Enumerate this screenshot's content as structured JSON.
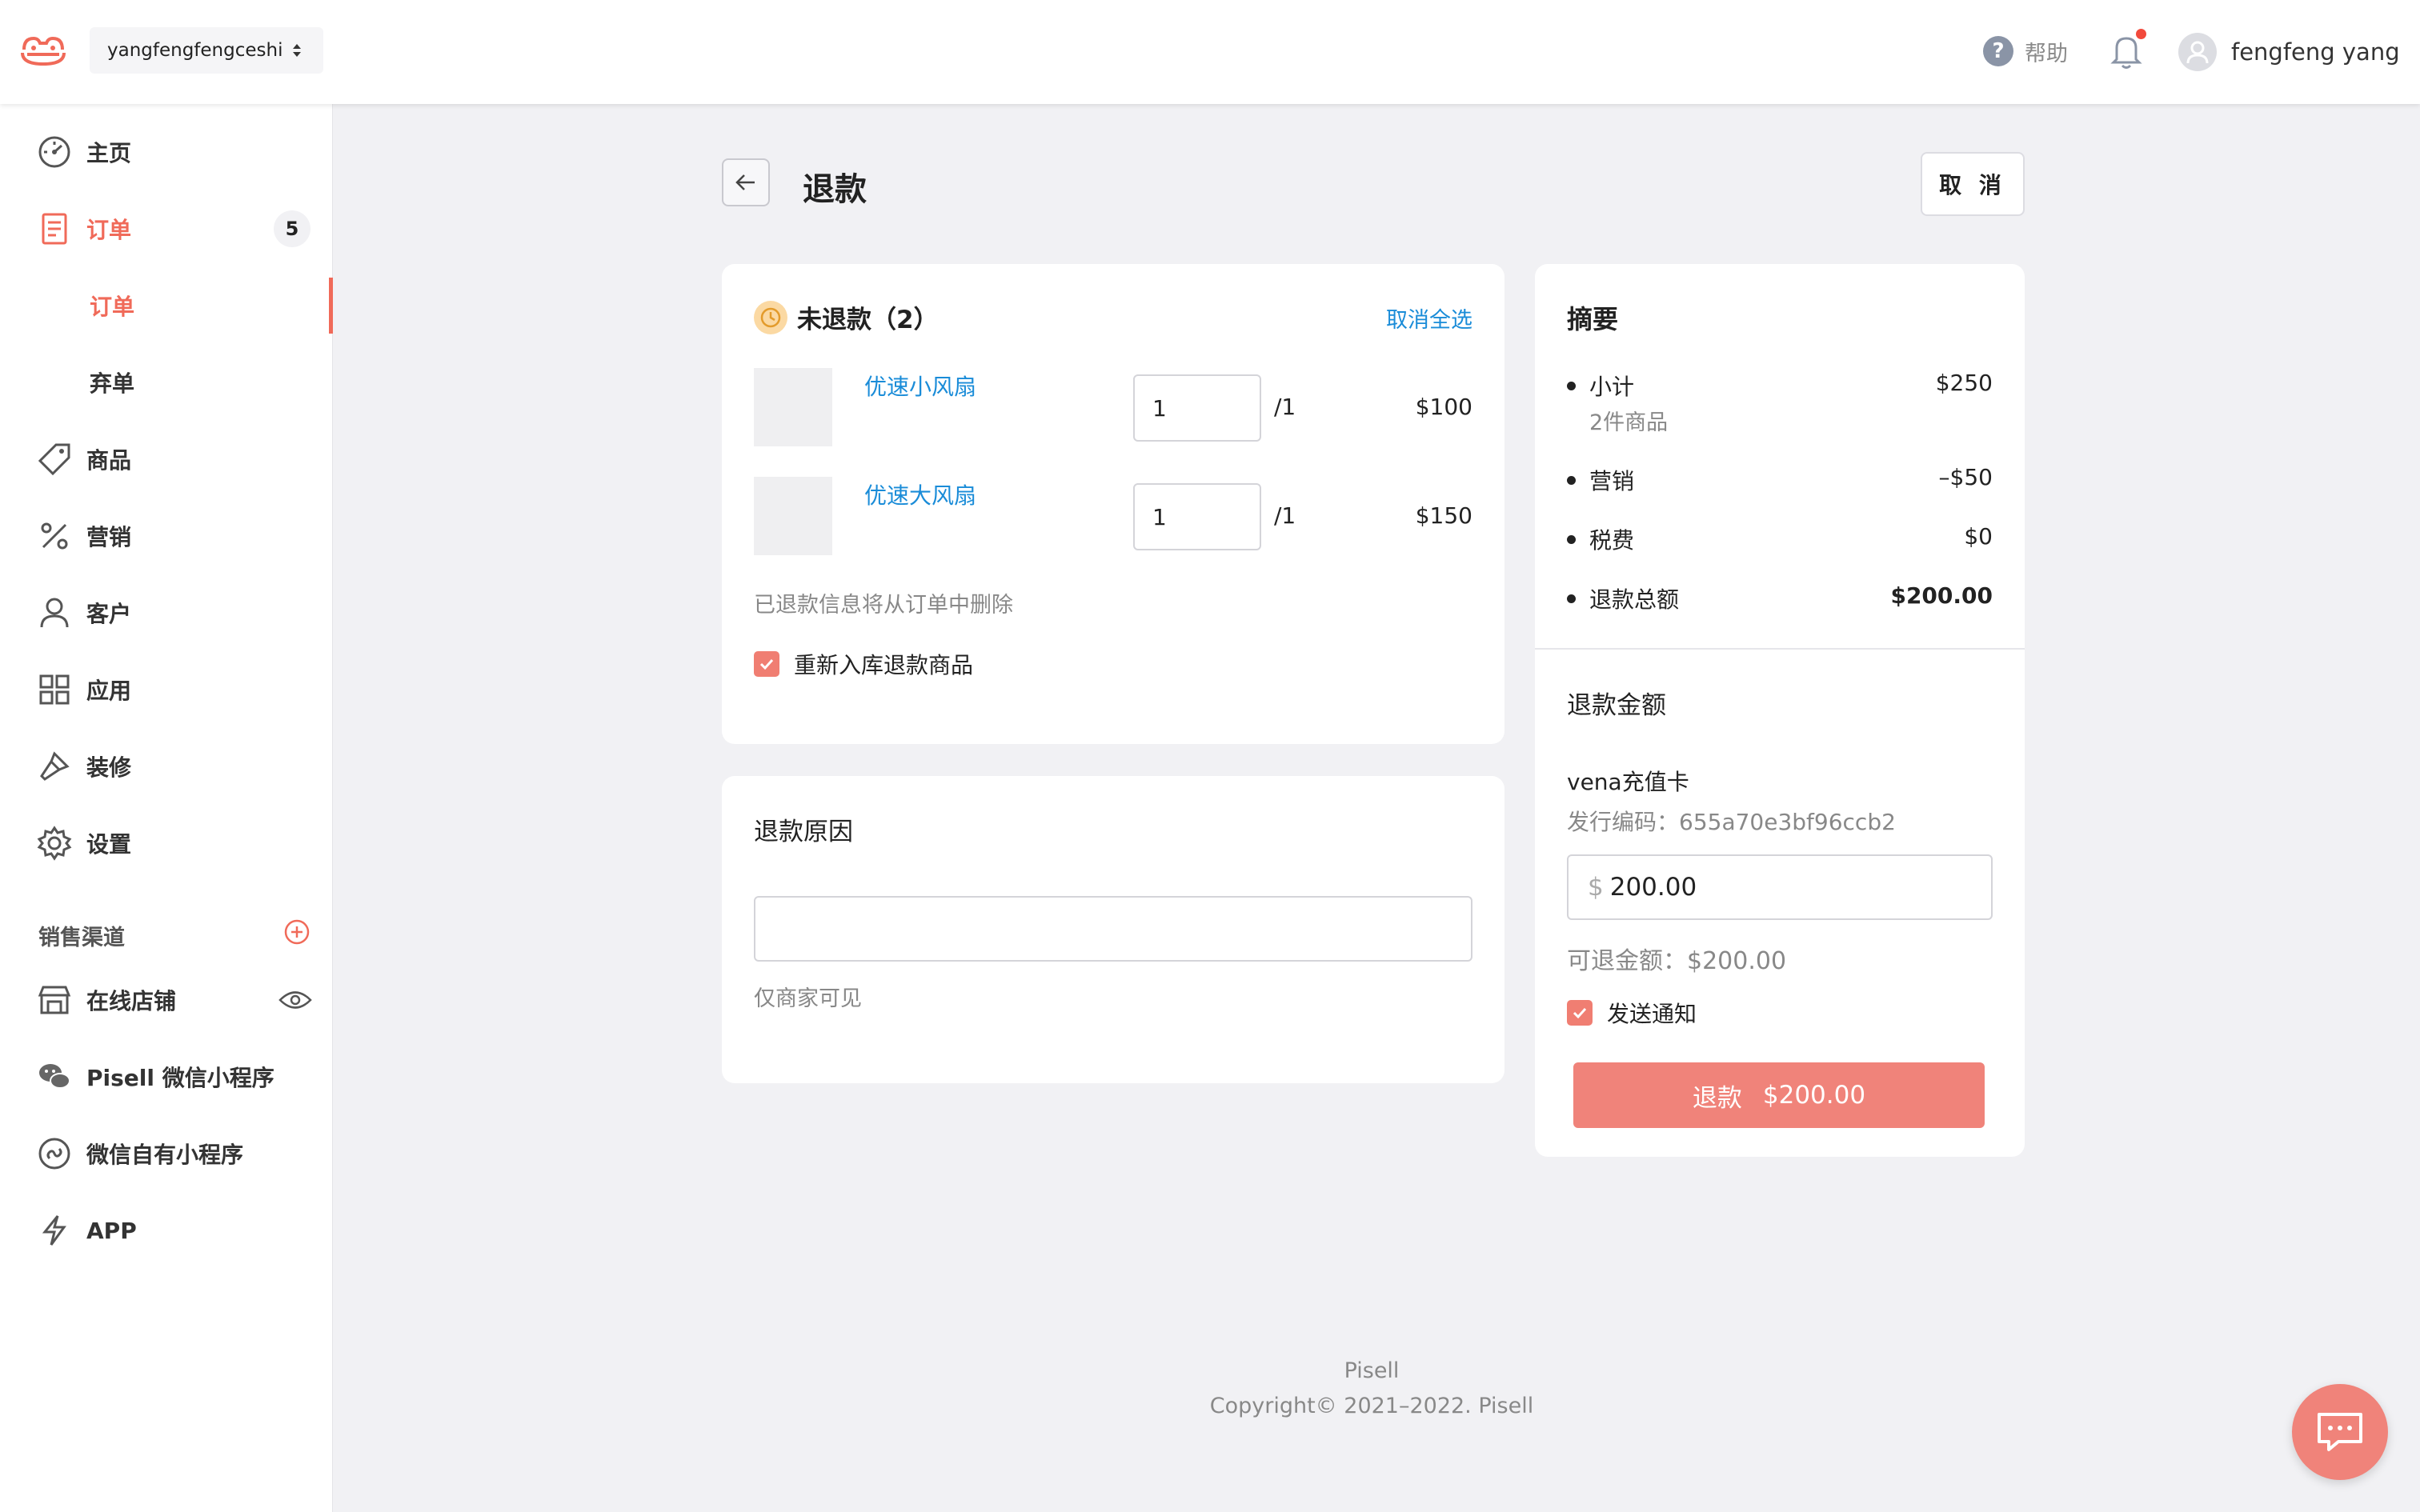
{
  "header": {
    "store_name": "yangfengfengceshi",
    "help_label": "帮助",
    "help_glyph": "?",
    "user_name": "fengfeng yang",
    "accent_color": "#f06a59"
  },
  "sidebar": {
    "items": [
      {
        "label": "主页",
        "icon": "dashboard-icon"
      },
      {
        "label": "订单",
        "icon": "orders-icon",
        "badge": "5"
      },
      {
        "label": "商品",
        "icon": "tag-icon"
      },
      {
        "label": "营销",
        "icon": "percent-icon"
      },
      {
        "label": "客户",
        "icon": "user-icon"
      },
      {
        "label": "应用",
        "icon": "apps-icon"
      },
      {
        "label": "装修",
        "icon": "brush-icon"
      },
      {
        "label": "设置",
        "icon": "gear-icon"
      }
    ],
    "sub_items": [
      {
        "label": "订单"
      },
      {
        "label": "弃单"
      }
    ],
    "sales_channels_label": "销售渠道",
    "channels": [
      {
        "label": "在线店铺",
        "icon": "store-icon"
      },
      {
        "label": "Pisell 微信小程序",
        "icon": "wechat-icon"
      },
      {
        "label": "微信自有小程序",
        "icon": "mini-program-icon"
      },
      {
        "label": "APP",
        "icon": "lightning-icon"
      }
    ]
  },
  "page": {
    "title": "退款",
    "cancel_label": "取 消"
  },
  "unrefunded": {
    "title": "未退款（2）",
    "deselect_label": "取消全选",
    "items": [
      {
        "name": "优速小风扇",
        "qty": "1",
        "max": "/1",
        "price": "$100"
      },
      {
        "name": "优速大风扇",
        "qty": "1",
        "max": "/1",
        "price": "$150"
      }
    ],
    "note": "已退款信息将从订单中删除",
    "restock_label": "重新入库退款商品"
  },
  "reason": {
    "title": "退款原因",
    "value": "",
    "hint": "仅商家可见"
  },
  "summary": {
    "title": "摘要",
    "subtotal_label": "小计",
    "subtotal_value": "$250",
    "subtotal_sub": "2件商品",
    "marketing_label": "营销",
    "marketing_value": "–$50",
    "tax_label": "税费",
    "tax_value": "$0",
    "total_label": "退款总额",
    "total_value": "$200.00"
  },
  "refund_amount": {
    "title": "退款金额",
    "card_name": "vena充值卡",
    "card_code": "发行编码：655a70e3bf96ccb2",
    "currency_symbol": "$",
    "amount": "200.00",
    "refundable": "可退金额：$200.00",
    "notify_label": "发送通知",
    "button_label": "退款",
    "button_amount": "$200.00"
  },
  "footer": {
    "brand": "Pisell",
    "copyright": "Copyright© 2021–2022. Pisell"
  }
}
